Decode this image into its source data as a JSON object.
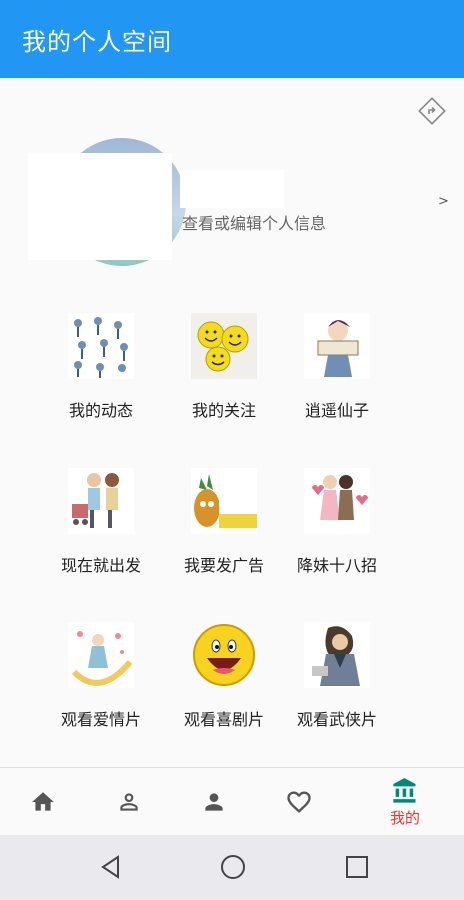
{
  "appbar": {
    "title": "我的个人空间"
  },
  "profile": {
    "edit_text": "查看或编辑个人信息",
    "chevron": ">"
  },
  "grid": [
    {
      "label": "我的动态",
      "icon": "people-collage-icon"
    },
    {
      "label": "我的关注",
      "icon": "smiley-buttons-icon"
    },
    {
      "label": "逍遥仙子",
      "icon": "reading-character-icon"
    },
    {
      "label": "现在就出发",
      "icon": "couple-shopping-icon"
    },
    {
      "label": "我要发广告",
      "icon": "pineapple-sign-icon"
    },
    {
      "label": "降妹十八招",
      "icon": "couple-hearts-icon"
    },
    {
      "label": "观看爱情片",
      "icon": "romance-illustration-icon"
    },
    {
      "label": "观看喜剧片",
      "icon": "laughing-face-icon"
    },
    {
      "label": "观看武侠片",
      "icon": "martial-artist-icon"
    }
  ],
  "bottom_nav": {
    "items": [
      "home-icon",
      "person-outline-icon",
      "person-icon",
      "heart-icon",
      "bank-icon"
    ],
    "active_label": "我的",
    "active_color": "#e53935",
    "active_icon_color": "#00897b"
  },
  "colors": {
    "appbar": "#2196f3"
  }
}
